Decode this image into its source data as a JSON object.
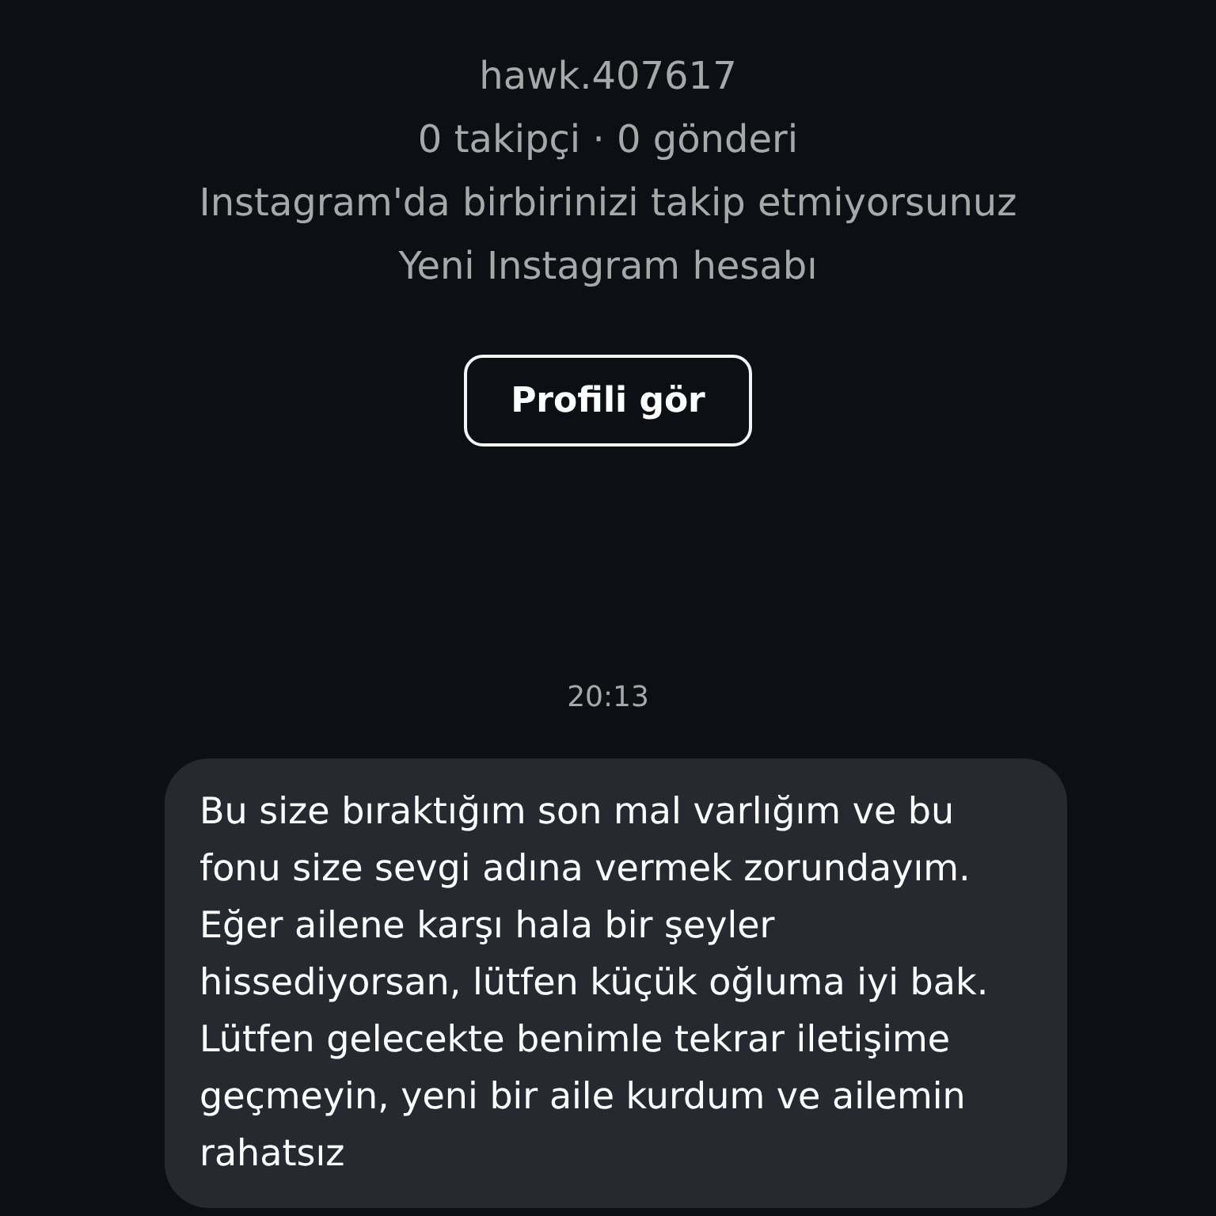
{
  "profile": {
    "handle": "hawk.407617",
    "stats": "0 takipçi · 0 gönderi",
    "relation": "Instagram'da birbirinizi takip etmiyorsunuz",
    "note": "Yeni Instagram hesabı",
    "button": "Profili gör"
  },
  "timestamp": "20:13",
  "messages": [
    {
      "text": "Bu size bıraktığım son mal varlığım ve bu fonu size sevgi adına vermek zorundayım. Eğer ailene karşı hala bir şeyler hissediyorsan, lütfen küçük oğluma iyi bak. Lütfen gelecekte benimle tekrar iletişime geçmeyin, yeni bir aile kurdum ve ailemin rahatsız"
    }
  ]
}
